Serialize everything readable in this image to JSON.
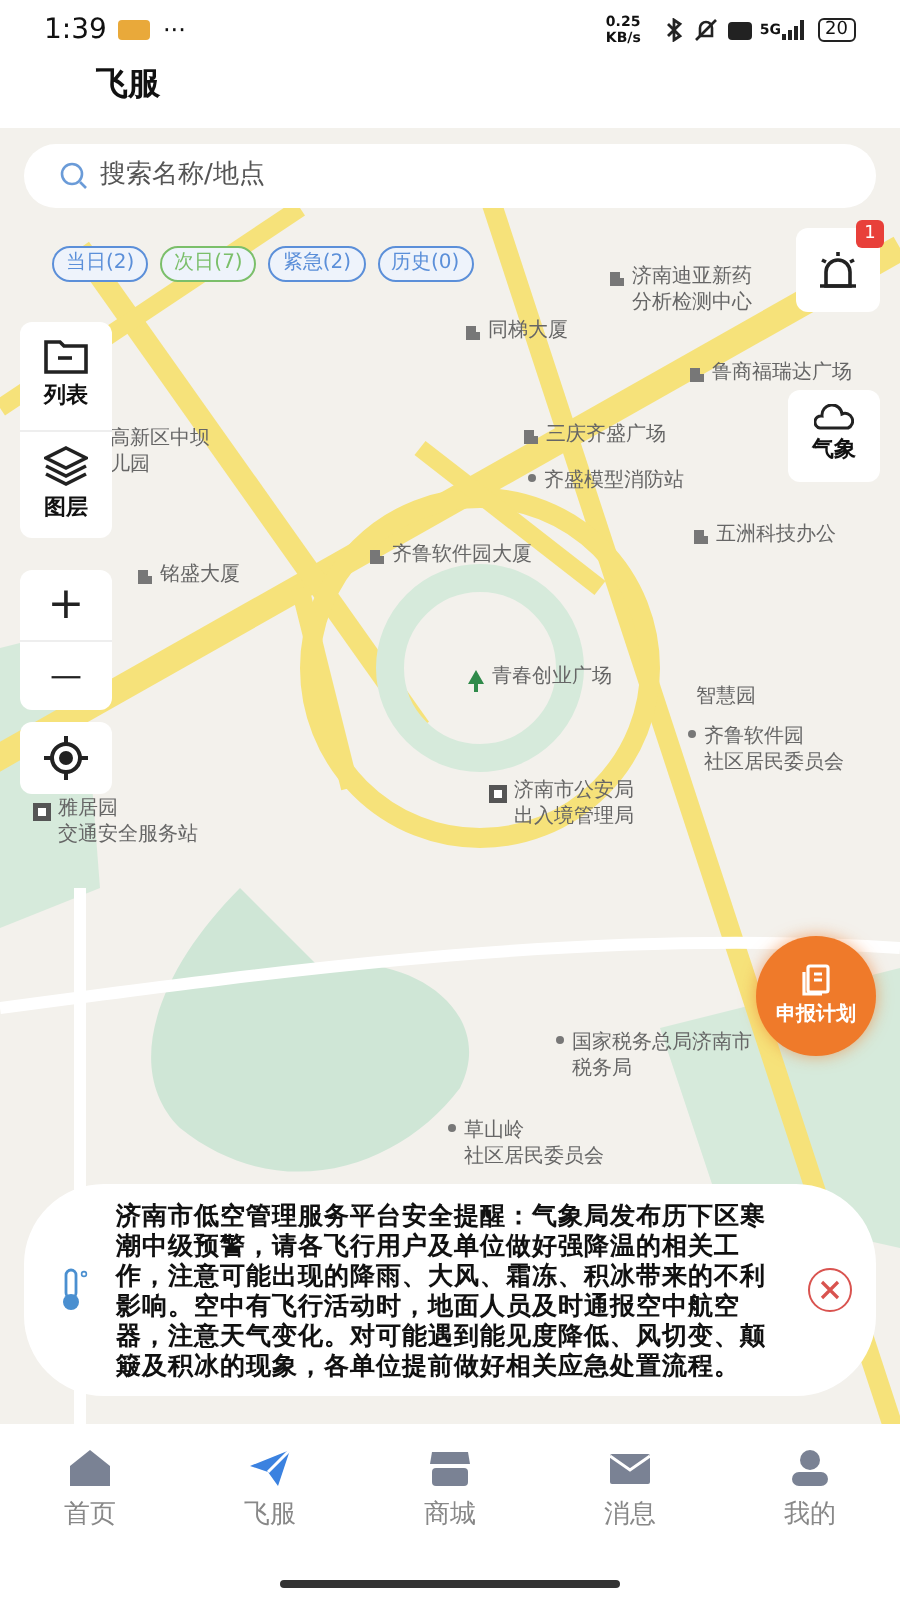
{
  "status_bar": {
    "time": "1:39",
    "more": "···",
    "speed": "0.25 KB/s",
    "network": "5G",
    "battery": "20"
  },
  "title": "飞服",
  "search": {
    "placeholder": "搜索名称/地点"
  },
  "filters": [
    {
      "label": "当日(2)",
      "color": "#5b8fd9"
    },
    {
      "label": "次日(7)",
      "color": "#7bbf6a"
    },
    {
      "label": "紧急(2)",
      "color": "#5b8fd9"
    },
    {
      "label": "历史(0)",
      "color": "#5b8fd9"
    }
  ],
  "map_labels": [
    {
      "kind": "building",
      "lines": [
        "济南迪亚新药",
        "分析检测中心"
      ]
    },
    {
      "kind": "building",
      "lines": [
        "同梯大厦"
      ]
    },
    {
      "kind": "building",
      "lines": [
        "鲁商福瑞达广场"
      ]
    },
    {
      "kind": "plain",
      "lines": [
        "高新区中坝",
        "儿园"
      ]
    },
    {
      "kind": "building",
      "lines": [
        "三庆齐盛广场"
      ]
    },
    {
      "kind": "dot",
      "lines": [
        "齐盛模型消防站"
      ]
    },
    {
      "kind": "building",
      "lines": [
        "五洲科技办公"
      ]
    },
    {
      "kind": "building",
      "lines": [
        "齐鲁软件园大厦"
      ]
    },
    {
      "kind": "building",
      "lines": [
        "铭盛大厦"
      ]
    },
    {
      "kind": "tree",
      "lines": [
        "青春创业广场"
      ]
    },
    {
      "kind": "plain",
      "lines": [
        "智慧园"
      ]
    },
    {
      "kind": "dot",
      "lines": [
        "齐鲁软件园",
        "社区居民委员会"
      ]
    },
    {
      "kind": "police",
      "lines": [
        "济南市公安局",
        "出入境管理局"
      ]
    },
    {
      "kind": "police",
      "lines": [
        "雅居园",
        "交通安全服务站"
      ]
    },
    {
      "kind": "dot",
      "lines": [
        "国家税务总局济南市",
        "税务局"
      ]
    },
    {
      "kind": "dot",
      "lines": [
        "草山岭",
        "社区居民委员会"
      ]
    }
  ],
  "alarm": {
    "badge": "1"
  },
  "weather": {
    "label": "气象"
  },
  "tools": [
    {
      "kind": "folder",
      "label": "列表"
    },
    {
      "kind": "layers",
      "label": "图层"
    }
  ],
  "zoom": {
    "in": "+",
    "out": "—"
  },
  "apply_button": {
    "label": "申报计划"
  },
  "notice": {
    "text": "济南市低空管理服务平台安全提醒：气象局发布历下区寒潮中级预警，请各飞行用户及单位做好强降温的相关工作，注意可能出现的降雨、大风、霜冻、积冰带来的不利影响。空中有飞行活动时，地面人员及时通报空中航空器，注意天气变化。对可能遇到能见度降低、风切变、颠簸及积冰的现象，各单位提前做好相关应急处置流程。"
  },
  "nav": [
    {
      "label": "首页",
      "kind": "home",
      "selected": false
    },
    {
      "label": "飞服",
      "kind": "plane",
      "selected": true
    },
    {
      "label": "商城",
      "kind": "shop",
      "selected": false
    },
    {
      "label": "消息",
      "kind": "mail",
      "selected": false
    },
    {
      "label": "我的",
      "kind": "user",
      "selected": false
    }
  ]
}
